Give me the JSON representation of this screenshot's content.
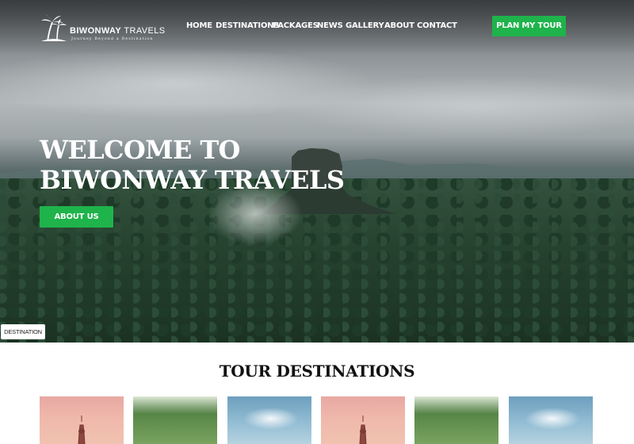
{
  "header": {
    "logo_icon": "palm-trees-icon",
    "brand_bold": "BIWONWAY",
    "brand_light": " TRAVELS",
    "tagline": "Journey Beyond a Destination",
    "nav": [
      "HOME",
      "DESTINATIONS",
      "PACKAGES",
      "NEWS",
      "GALLERY",
      "ABOUT",
      "CONTACT"
    ],
    "cta_label": "PLAN MY TOUR"
  },
  "hero": {
    "title_line1": "WELCOME TO",
    "title_line2": "BIWONWAY TRAVELS",
    "button_label": "ABOUT US",
    "chip_label": "DESTINATION"
  },
  "destinations": {
    "title": "TOUR DESTINATIONS",
    "cards": [
      {
        "scene": "sunset-tower"
      },
      {
        "scene": "green-hill"
      },
      {
        "scene": "cloudy-sky"
      },
      {
        "scene": "sunset-tower"
      },
      {
        "scene": "green-hill"
      },
      {
        "scene": "cloudy-sky"
      }
    ]
  },
  "colors": {
    "accent_green": "#1fb34b",
    "text_dark": "#111111",
    "white": "#ffffff"
  }
}
